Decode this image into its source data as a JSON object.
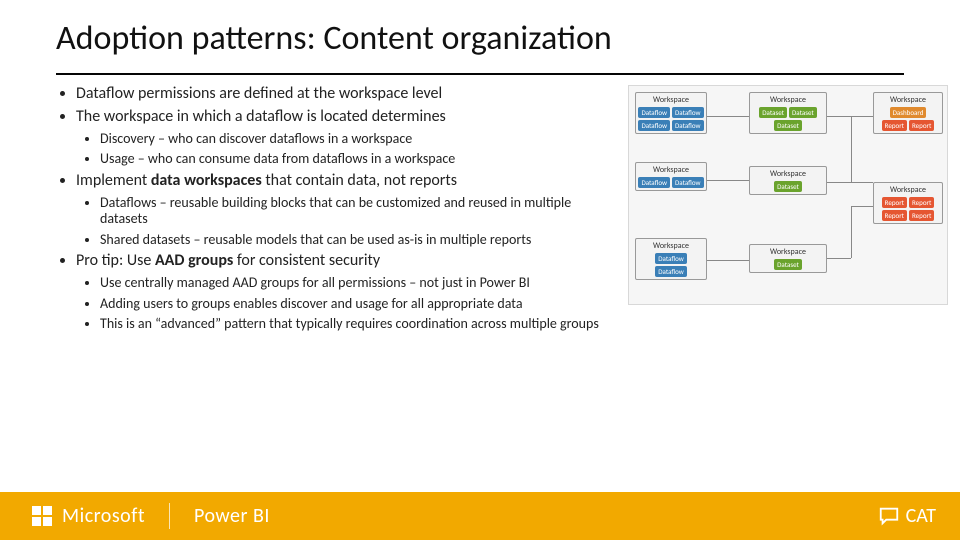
{
  "title": "Adoption patterns: Content organization",
  "bullets": {
    "b1": "Dataflow permissions are defined at the workspace level",
    "b2": "The workspace in which a dataflow is located determines",
    "b2a": "Discovery – who can discover dataflows in a workspace",
    "b2b": "Usage – who can consume data from dataflows in a workspace",
    "b3_pre": "Implement ",
    "b3_bold": "data workspaces",
    "b3_post": " that contain data, not reports",
    "b3a": "Dataflows – reusable building blocks that can be customized and reused in multiple datasets",
    "b3b": "Shared datasets – reusable models that can be used as-is in multiple reports",
    "b4_pre": "Pro tip: Use ",
    "b4_bold": "AAD groups",
    "b4_post": " for consistent security",
    "b4a": "Use centrally managed AAD groups for all permissions – not just in Power BI",
    "b4b": "Adding users to groups enables discover and usage for all appropriate data",
    "b4c": "This is an “advanced” pattern that typically requires coordination across multiple groups"
  },
  "diagram": {
    "workspace": "Workspace",
    "dataflow": "Dataflow",
    "dataset": "Dataset",
    "dashboard": "Dashboard",
    "report": "Report"
  },
  "footer": {
    "ms": "Microsoft",
    "pbi": "Power BI",
    "cat": "CAT"
  }
}
